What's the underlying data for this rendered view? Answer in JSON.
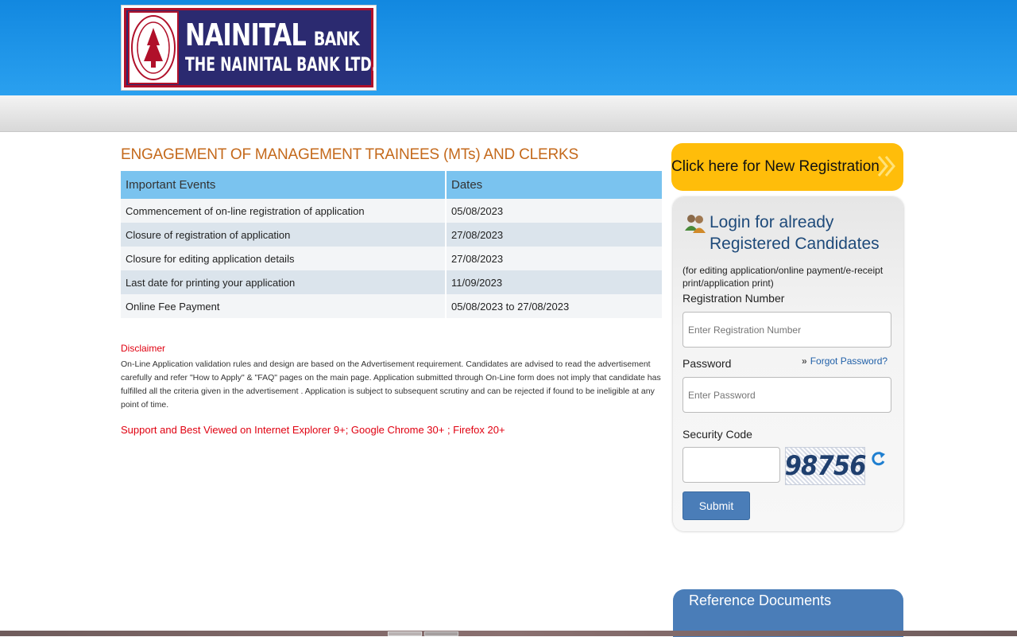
{
  "header": {
    "logo_line1": "NAINITAL",
    "logo_line1_small": "BANK",
    "logo_line2": "THE NAINITAL BANK LTD."
  },
  "main": {
    "title": "ENGAGEMENT OF MANAGEMENT TRAINEES (MTs) AND CLERKS",
    "events_table": {
      "headers": [
        "Important Events",
        "Dates"
      ],
      "rows": [
        {
          "event": "Commencement of on-line registration of application",
          "date": "05/08/2023"
        },
        {
          "event": "Closure of registration of application",
          "date": "27/08/2023"
        },
        {
          "event": "Closure for editing application details",
          "date": "27/08/2023"
        },
        {
          "event": "Last date for printing your application",
          "date": "11/09/2023"
        },
        {
          "event": "Online Fee Payment",
          "date": "05/08/2023 to 27/08/2023"
        }
      ]
    },
    "disclaimer_title": "Disclaimer",
    "disclaimer_text": "On-Line Application validation rules and design are based on the Advertisement requirement. Candidates are advised to read the advertisement carefully and refer \"How to Apply\" & \"FAQ\" pages on the main page. Application submitted through On-Line form does not imply that candidate has fulfilled all the criteria given in the advertisement . Application is subject to subsequent scrutiny and can be rejected if found to be ineligible at any point of time.",
    "support_text": "Support and Best Viewed on Internet Explorer 9+; Google Chrome 30+ ; Firefox 20+"
  },
  "sidebar": {
    "new_registration_label": "Click here for New Registration",
    "login": {
      "title_line1": "Login for already",
      "title_line2": "Registered Candidates",
      "note": "(for editing application/online payment/e-receipt print/application print)",
      "registration_label": "Registration Number",
      "registration_placeholder": "Enter Registration Number",
      "password_label": "Password",
      "password_placeholder": "Enter Password",
      "forgot_password": "Forgot Password?",
      "security_code_label": "Security Code",
      "captcha_text": "98756",
      "submit_label": "Submit"
    },
    "reference_documents_title": "Reference Documents"
  },
  "colors": {
    "header_blue": "#1288e0",
    "title_orange": "#c4691b",
    "table_header": "#7ac3ef",
    "disclaimer_red": "#e00010",
    "new_reg_yellow": "#ffbd0a",
    "button_blue": "#4a7db8"
  },
  "icons": {
    "logo_seal": "bank-seal-icon",
    "new_registration": "double-chevron-right-icon",
    "login": "users-icon",
    "forgot_password": "double-chevron-right-icon",
    "captcha_refresh": "refresh-icon"
  }
}
